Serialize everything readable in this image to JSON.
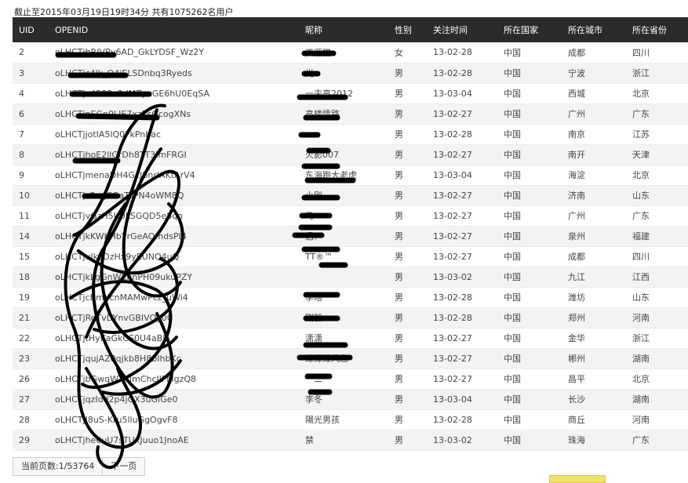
{
  "header": {
    "summary": "截止至2015年03月19日19时34分 共有1075262名用户"
  },
  "table": {
    "columns": [
      "UID",
      "OPENID",
      "昵称",
      "性别",
      "关注时间",
      "所在国家",
      "所在城市",
      "所在省份"
    ],
    "rows": [
      [
        "2",
        "oLHCTjhRIVRy6AD_GkLYDSF_Wz2Y",
        "天涯猫",
        "女",
        "13-02-28",
        "中国",
        "成都",
        "四川"
      ],
      [
        "3",
        "oLHCTjc4lk_Q4jELSDnbq3Ryeds",
        "光",
        "男",
        "13-02-28",
        "中国",
        "宁波",
        "浙江"
      ],
      [
        "4",
        "oLHCTjv4288o2dMZpcGE6hU0EqSA",
        "一夫高2012",
        "男",
        "13-03-04",
        "中国",
        "西城",
        "北京"
      ],
      [
        "6",
        "oLHCTjnEGp0LIE7xzEsGcogXNs",
        "高楼情路",
        "男",
        "13-02-27",
        "中国",
        "广州",
        "广东"
      ],
      [
        "7",
        "oLHCTjjotIA5lQ0FkPnbac",
        "n",
        "男",
        "13-02-28",
        "中国",
        "南京",
        "江苏"
      ],
      [
        "8",
        "oLHCTjhoE2llGrDh8TT3ImFRGI",
        "火影007",
        "男",
        "13-02-27",
        "中国",
        "南开",
        "天津"
      ],
      [
        "9",
        "oLHCTjmenaDH4GcJbnrIAKtArV4",
        "东海跑大老虎",
        "男",
        "13-03-04",
        "中国",
        "海淀",
        "北京"
      ],
      [
        "10",
        "oLHCTjs8uqCGaToPN4oWM8Q",
        "小刚",
        "男",
        "13-02-27",
        "中国",
        "济南",
        "山东"
      ],
      [
        "11",
        "oLHCTjvGzH5U0LSGQD5e8qo",
        "马",
        "男",
        "13-02-27",
        "中国",
        "广州",
        "广东"
      ],
      [
        "14",
        "oLHCTjkKWhHbYrGeAOfndsPI4",
        "遇？",
        "男",
        "13-02-27",
        "中国",
        "泉州",
        "福建"
      ],
      [
        "15",
        "oLHCTjuIkcDzHx9yEUNQ4uQ",
        "TT®™",
        "男",
        "13-02-27",
        "中国",
        "成都",
        "四川"
      ],
      [
        "18",
        "oLHCTjkLgGnWEnnPH09ukuPZY",
        "",
        "男",
        "13-03-02",
        "中国",
        "九江",
        "江西"
      ],
      [
        "19",
        "oLHCTjcBmYcnMAMwPcz_uWi4",
        "李培",
        "男",
        "13-02-28",
        "中国",
        "潍坊",
        "山东"
      ],
      [
        "21",
        "oLHCTjReTvDYnvGBIVQy00",
        "刚毅",
        "男",
        "13-02-28",
        "中国",
        "郑州",
        "河南"
      ],
      [
        "22",
        "oLHCTjtHyKaGkCS0U4aBJI",
        "潇潇",
        "男",
        "13-02-27",
        "中国",
        "金华",
        "浙江"
      ],
      [
        "23",
        "oLHCTjqujAZ0qjkb8H8bIhbKc",
        "绿绿绿风您",
        "男",
        "13-02-27",
        "中国",
        "郴州",
        "湖南"
      ],
      [
        "26",
        "oLHCTjbGwqWTwJmChcJlFMgzQ8",
        "一二",
        "男",
        "13-02-27",
        "中国",
        "昌平",
        "北京"
      ],
      [
        "27",
        "oLHCTjqzIdd2p4jGX3uGlGe0",
        "李冬",
        "男",
        "13-03-04",
        "中国",
        "长沙",
        "湖南"
      ],
      [
        "28",
        "oLHCTjJ8uS-Kru5lluGgOgvF8",
        "陽光男孩",
        "男",
        "13-02-28",
        "中国",
        "商丘",
        "河南"
      ],
      [
        "29",
        "oLHCTjhe6uU7sTUxJuuo1JnoAE",
        "禁",
        "男",
        "13-03-02",
        "中国",
        "珠海",
        "广东"
      ]
    ]
  },
  "pager": {
    "current_page_label": "当前页数:1/53764",
    "next_label": "下一页"
  },
  "colors": {
    "header_bg": "#2b2b2b",
    "scribble": "#000000"
  }
}
